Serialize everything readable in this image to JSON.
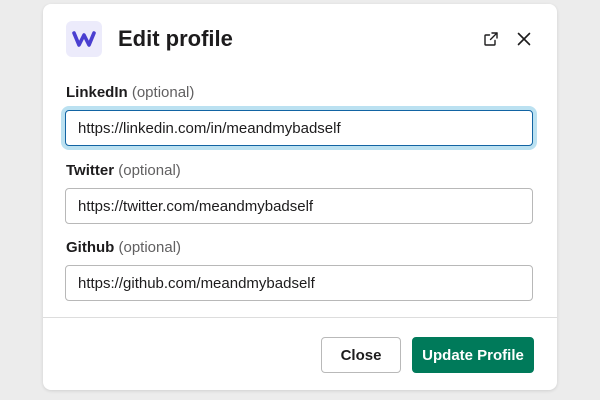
{
  "dialog": {
    "title": "Edit profile"
  },
  "fields": [
    {
      "label": "LinkedIn",
      "optional": "(optional)",
      "value": "https://linkedin.com/in/meandmybadself"
    },
    {
      "label": "Twitter",
      "optional": "(optional)",
      "value": "https://twitter.com/meandmybadself"
    },
    {
      "label": "Github",
      "optional": "(optional)",
      "value": "https://github.com/meandmybadself"
    }
  ],
  "footer": {
    "close_label": "Close",
    "update_label": "Update Profile"
  },
  "colors": {
    "primary_button": "#007a5a",
    "logo_accent": "#4a3fd0",
    "logo_background": "#ecebfb",
    "focus_ring": "#1264a3"
  },
  "icons": {
    "logo": "w-logo-icon",
    "open": "external-link-icon",
    "close": "close-icon"
  }
}
